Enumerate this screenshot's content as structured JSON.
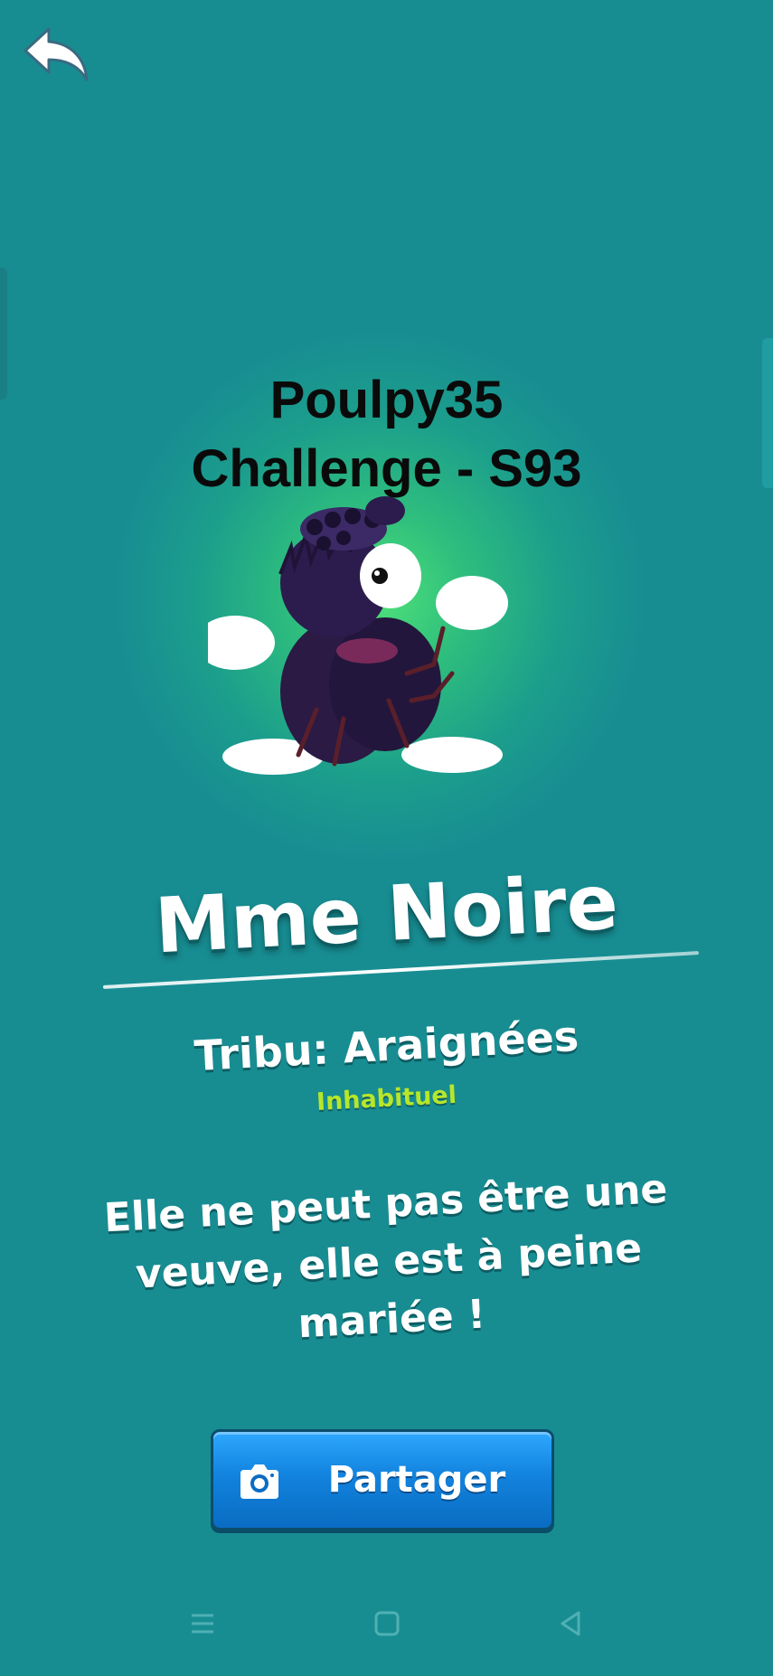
{
  "header": {
    "back_icon": "back-arrow-icon"
  },
  "challenge": {
    "line1": "Poulpy35",
    "line2": "Challenge - S93"
  },
  "character": {
    "name": "Mme Noire",
    "tribe": "Tribu: Araignées",
    "rarity": "Inhabituel",
    "description": "Elle ne peut pas être une veuve, elle est à peine mariée !"
  },
  "share": {
    "label": "Partager",
    "icon": "camera-icon"
  },
  "navbar": {
    "items": [
      "menu-icon",
      "home-square-icon",
      "back-triangle-icon"
    ]
  },
  "colors": {
    "background": "#178d92",
    "glow": "#4fe07a",
    "rarity": "#b7e62a",
    "button": "#1283de"
  }
}
